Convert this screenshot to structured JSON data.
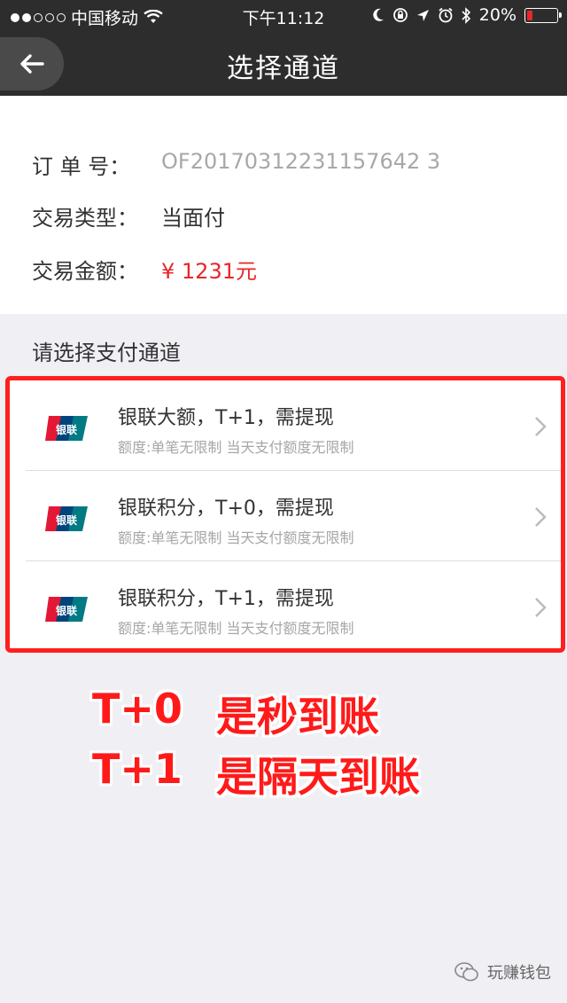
{
  "status_bar": {
    "carrier": "中国移动",
    "time": "下午11:12",
    "battery": "20%",
    "battery_level": 0.2
  },
  "nav": {
    "back_icon": "arrow-left-icon",
    "title": "选择通道"
  },
  "order": {
    "rows": [
      {
        "label": "订 单 号：",
        "value": "OF20170312231157642 3"
      },
      {
        "label": "交易类型：",
        "value": "当面付"
      },
      {
        "label": "交易金额：",
        "value": "¥ 1231元"
      }
    ]
  },
  "channels": {
    "section_title": "请选择支付通道",
    "items": [
      {
        "title": "银联大额，T+1，需提现",
        "subtitle": "额度:单笔无限制 当天支付额度无限制",
        "logo_text": "银联"
      },
      {
        "title": "银联积分，T+0，需提现",
        "subtitle": "额度:单笔无限制 当天支付额度无限制",
        "logo_text": "银联"
      },
      {
        "title": "银联积分，T+1，需提现",
        "subtitle": "额度:单笔无限制 当天支付额度无限制",
        "logo_text": "银联"
      }
    ]
  },
  "annotations": [
    {
      "key": "T+0",
      "text": "是秒到账"
    },
    {
      "key": "T+1",
      "text": "是隔天到账"
    }
  ],
  "watermark": "玩赚钱包",
  "colors": {
    "accent_red": "#e8262b",
    "header_bg": "#2d2d2d",
    "highlight_border": "#ff1f1f"
  }
}
